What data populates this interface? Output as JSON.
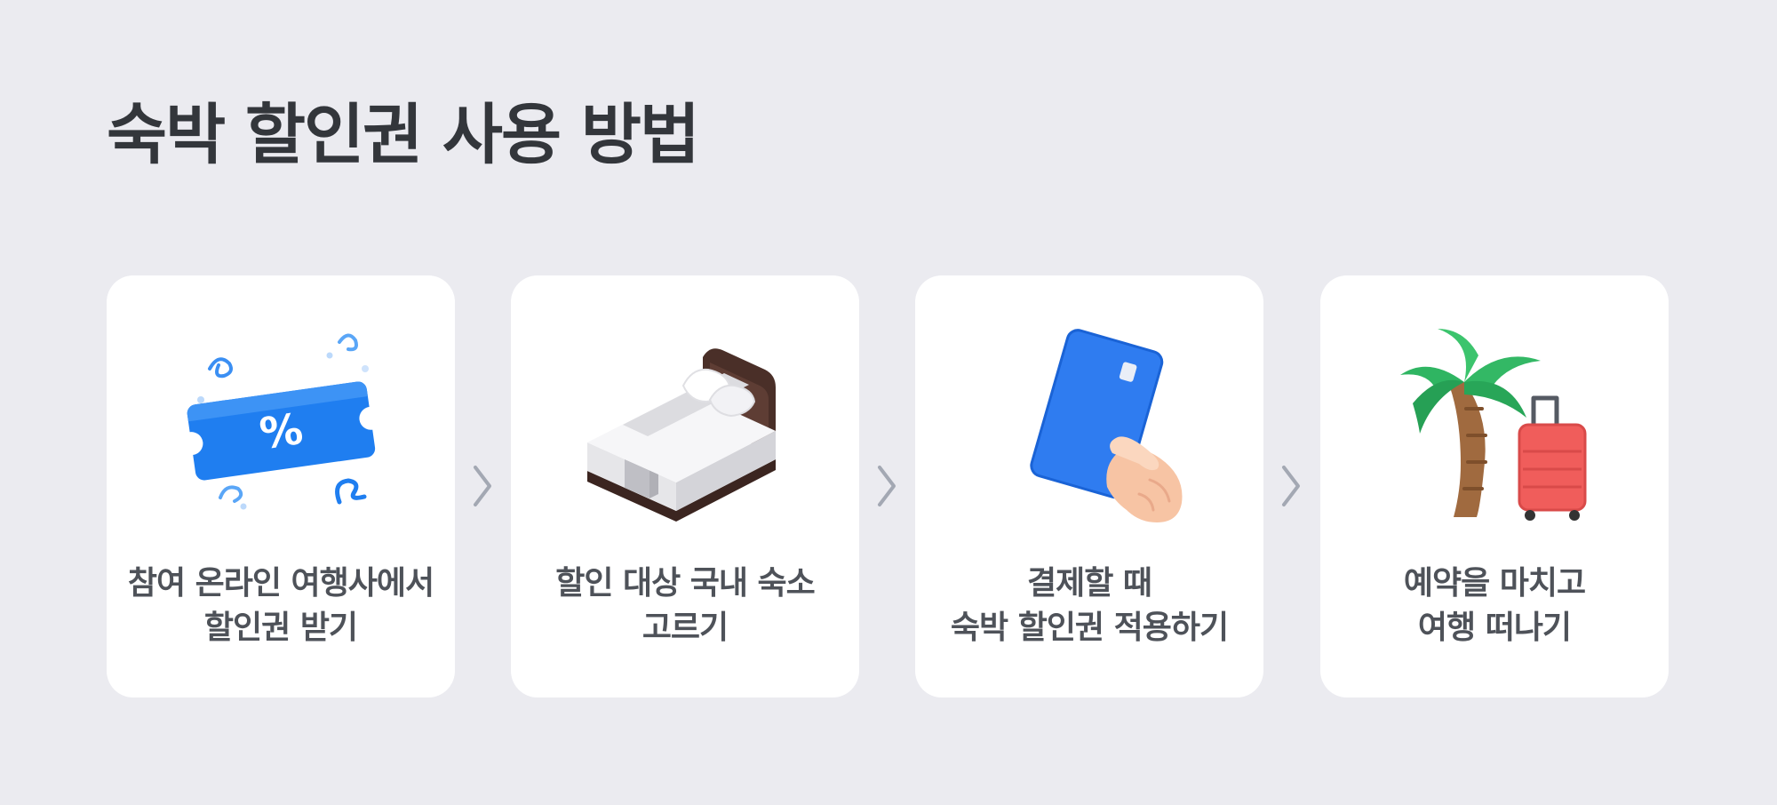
{
  "title": "숙박 할인권 사용 방법",
  "steps": [
    {
      "line1": "참여 온라인 여행사에서",
      "line2": "할인권 받기",
      "icon": "discount-ticket-icon",
      "ticket_symbol": "%"
    },
    {
      "line1": "할인 대상 국내 숙소",
      "line2": "고르기",
      "icon": "bed-icon"
    },
    {
      "line1": "결제할 때",
      "line2": "숙박 할인권 적용하기",
      "icon": "card-in-hand-icon"
    },
    {
      "line1": "예약을 마치고",
      "line2": "여행 떠나기",
      "icon": "palm-tree-suitcase-icon"
    }
  ],
  "colors": {
    "background": "#ebebf0",
    "card": "#ffffff",
    "title": "#33363b",
    "label": "#4e5259",
    "arrow": "#a3a8b3",
    "accent_blue": "#1f7ef0"
  }
}
